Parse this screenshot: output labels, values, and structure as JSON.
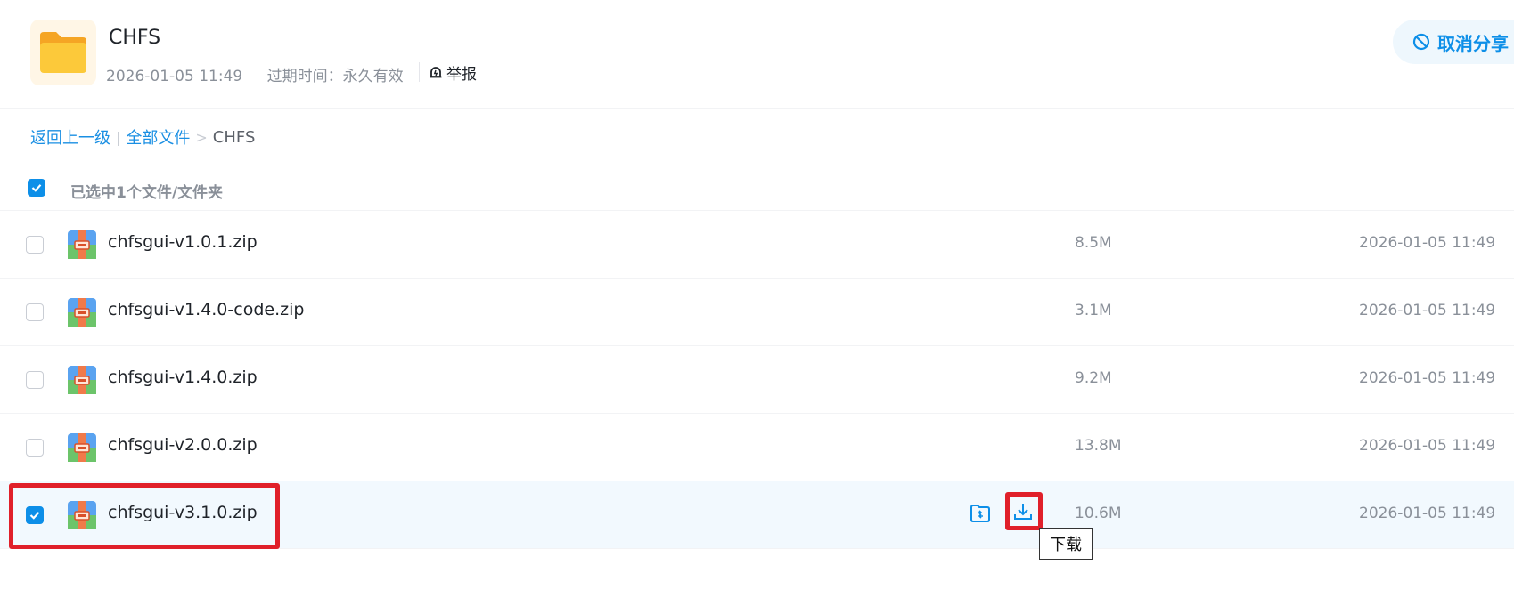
{
  "header": {
    "title": "CHFS",
    "date": "2026-01-05 11:49",
    "expire_label": "过期时间：永久有效",
    "report_label": "举报",
    "cancel_share_label": "取消分享"
  },
  "breadcrumb": {
    "back": "返回上一级",
    "all_files": "全部文件",
    "separator": ">",
    "current": "CHFS"
  },
  "selection": {
    "text": "已选中1个文件/文件夹",
    "all_checked": true
  },
  "files": [
    {
      "name": "chfsgui-v1.0.1.zip",
      "size": "8.5M",
      "date": "2026-01-05 11:49",
      "checked": false
    },
    {
      "name": "chfsgui-v1.4.0-code.zip",
      "size": "3.1M",
      "date": "2026-01-05 11:49",
      "checked": false
    },
    {
      "name": "chfsgui-v1.4.0.zip",
      "size": "9.2M",
      "date": "2026-01-05 11:49",
      "checked": false
    },
    {
      "name": "chfsgui-v2.0.0.zip",
      "size": "13.8M",
      "date": "2026-01-05 11:49",
      "checked": false
    },
    {
      "name": "chfsgui-v3.1.0.zip",
      "size": "10.6M",
      "date": "2026-01-05 11:49",
      "checked": true
    }
  ],
  "tooltip": {
    "download": "下载"
  },
  "colors": {
    "accent": "#0d8fe8",
    "highlight": "#e0202a",
    "selected_row": "#f2f9fe"
  }
}
